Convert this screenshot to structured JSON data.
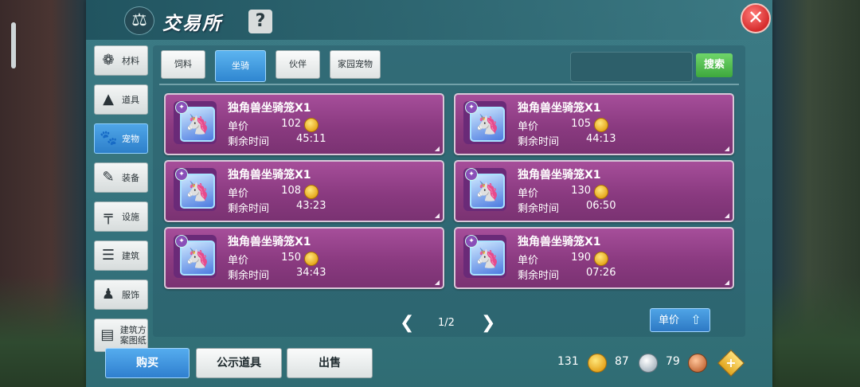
{
  "window": {
    "title": "交易所",
    "help_label": "?",
    "close_label": "✕"
  },
  "sidebar": {
    "items": [
      {
        "label": "材料",
        "icon": "materials-icon"
      },
      {
        "label": "道具",
        "icon": "tools-icon"
      },
      {
        "label": "宠物",
        "icon": "paw-icon",
        "active": true
      },
      {
        "label": "装备",
        "icon": "equipment-icon"
      },
      {
        "label": "设施",
        "icon": "facility-icon"
      },
      {
        "label": "建筑",
        "icon": "building-icon"
      },
      {
        "label": "服饰",
        "icon": "clothing-icon"
      },
      {
        "label": "建筑方案图纸",
        "icon": "blueprint-icon"
      }
    ]
  },
  "tabs": [
    {
      "label": "饲料"
    },
    {
      "label": "坐骑",
      "active": true
    },
    {
      "label": "伙伴"
    },
    {
      "label": "家园宠物"
    }
  ],
  "search": {
    "button_label": "搜索",
    "value": ""
  },
  "listing_labels": {
    "price": "单价",
    "time_left": "剩余时间"
  },
  "listings": [
    {
      "name": "独角兽坐骑笼X1",
      "price": "102",
      "time": "45:11"
    },
    {
      "name": "独角兽坐骑笼X1",
      "price": "105",
      "time": "44:13"
    },
    {
      "name": "独角兽坐骑笼X1",
      "price": "108",
      "time": "43:23"
    },
    {
      "name": "独角兽坐骑笼X1",
      "price": "130",
      "time": "06:50"
    },
    {
      "name": "独角兽坐骑笼X1",
      "price": "150",
      "time": "34:43"
    },
    {
      "name": "独角兽坐骑笼X1",
      "price": "190",
      "time": "07:26"
    }
  ],
  "pagination": {
    "text": "1/2"
  },
  "sort": {
    "label": "单价"
  },
  "bottom": {
    "buy": "购买",
    "public_items": "公示道具",
    "sell": "出售"
  },
  "currency": {
    "gold": "131",
    "silver": "87",
    "copper": "79"
  }
}
